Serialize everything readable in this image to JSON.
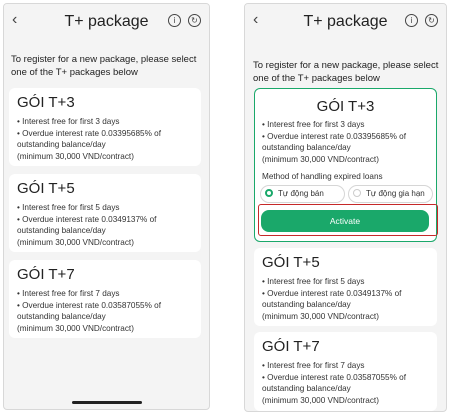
{
  "header": {
    "title": "T+ package",
    "back_icon": "chevron-left-icon",
    "info_icon": "info-icon",
    "history_icon": "history-icon"
  },
  "intro": "To register for a new package, please select one of the T+ packages below",
  "packages": [
    {
      "name": "GÓI T+3",
      "free": "• Interest free for first 3 days",
      "overdue": "• Overdue interest rate 0.03395685% of",
      "balance": "outstanding balance/day",
      "minimum": "(minimum 30,000 VND/contract)"
    },
    {
      "name": "GÓI T+5",
      "free": "• Interest free for first 5 days",
      "overdue": "• Overdue interest rate 0.0349137% of",
      "balance": "outstanding balance/day",
      "minimum": "(minimum 30,000 VND/contract)"
    },
    {
      "name": "GÓI T+7",
      "free": "• Interest free for first 7 days",
      "overdue": "• Overdue interest rate 0.03587055% of",
      "balance": "outstanding balance/day",
      "minimum": "(minimum 30,000 VND/contract)"
    }
  ],
  "expired": {
    "label": "Method of handling expired loans",
    "options": [
      {
        "label": "Tự động bán",
        "selected": true
      },
      {
        "label": "Tự động gia hạn",
        "selected": false
      }
    ]
  },
  "activate_label": "Activate",
  "colors": {
    "accent": "#1aa86a",
    "highlight": "#c62828"
  }
}
